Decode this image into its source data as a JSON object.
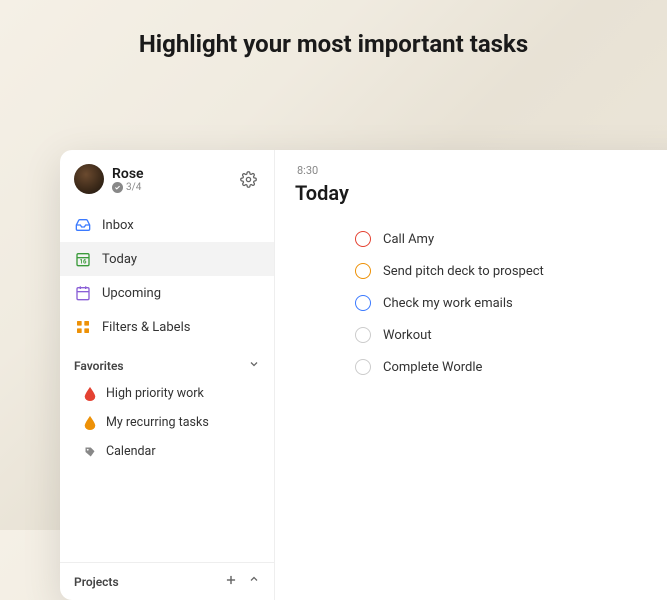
{
  "hero": {
    "title": "Highlight your most important tasks"
  },
  "user": {
    "name": "Rose",
    "stats": "3/4"
  },
  "nav": {
    "inbox": "Inbox",
    "today": "Today",
    "upcoming": "Upcoming",
    "filters": "Filters & Labels"
  },
  "favorites": {
    "header": "Favorites",
    "items": [
      {
        "label": "High priority work",
        "color": "#e44232"
      },
      {
        "label": "My recurring tasks",
        "color": "#ed9107"
      },
      {
        "label": "Calendar",
        "color": "#888"
      }
    ]
  },
  "projects": {
    "header": "Projects"
  },
  "main": {
    "time": "8:30",
    "title": "Today"
  },
  "tasks": [
    {
      "label": "Call Amy",
      "priority": "p1"
    },
    {
      "label": "Send pitch deck to prospect",
      "priority": "p2"
    },
    {
      "label": "Check my work emails",
      "priority": "p3"
    },
    {
      "label": "Workout",
      "priority": ""
    },
    {
      "label": "Complete Wordle",
      "priority": ""
    }
  ]
}
